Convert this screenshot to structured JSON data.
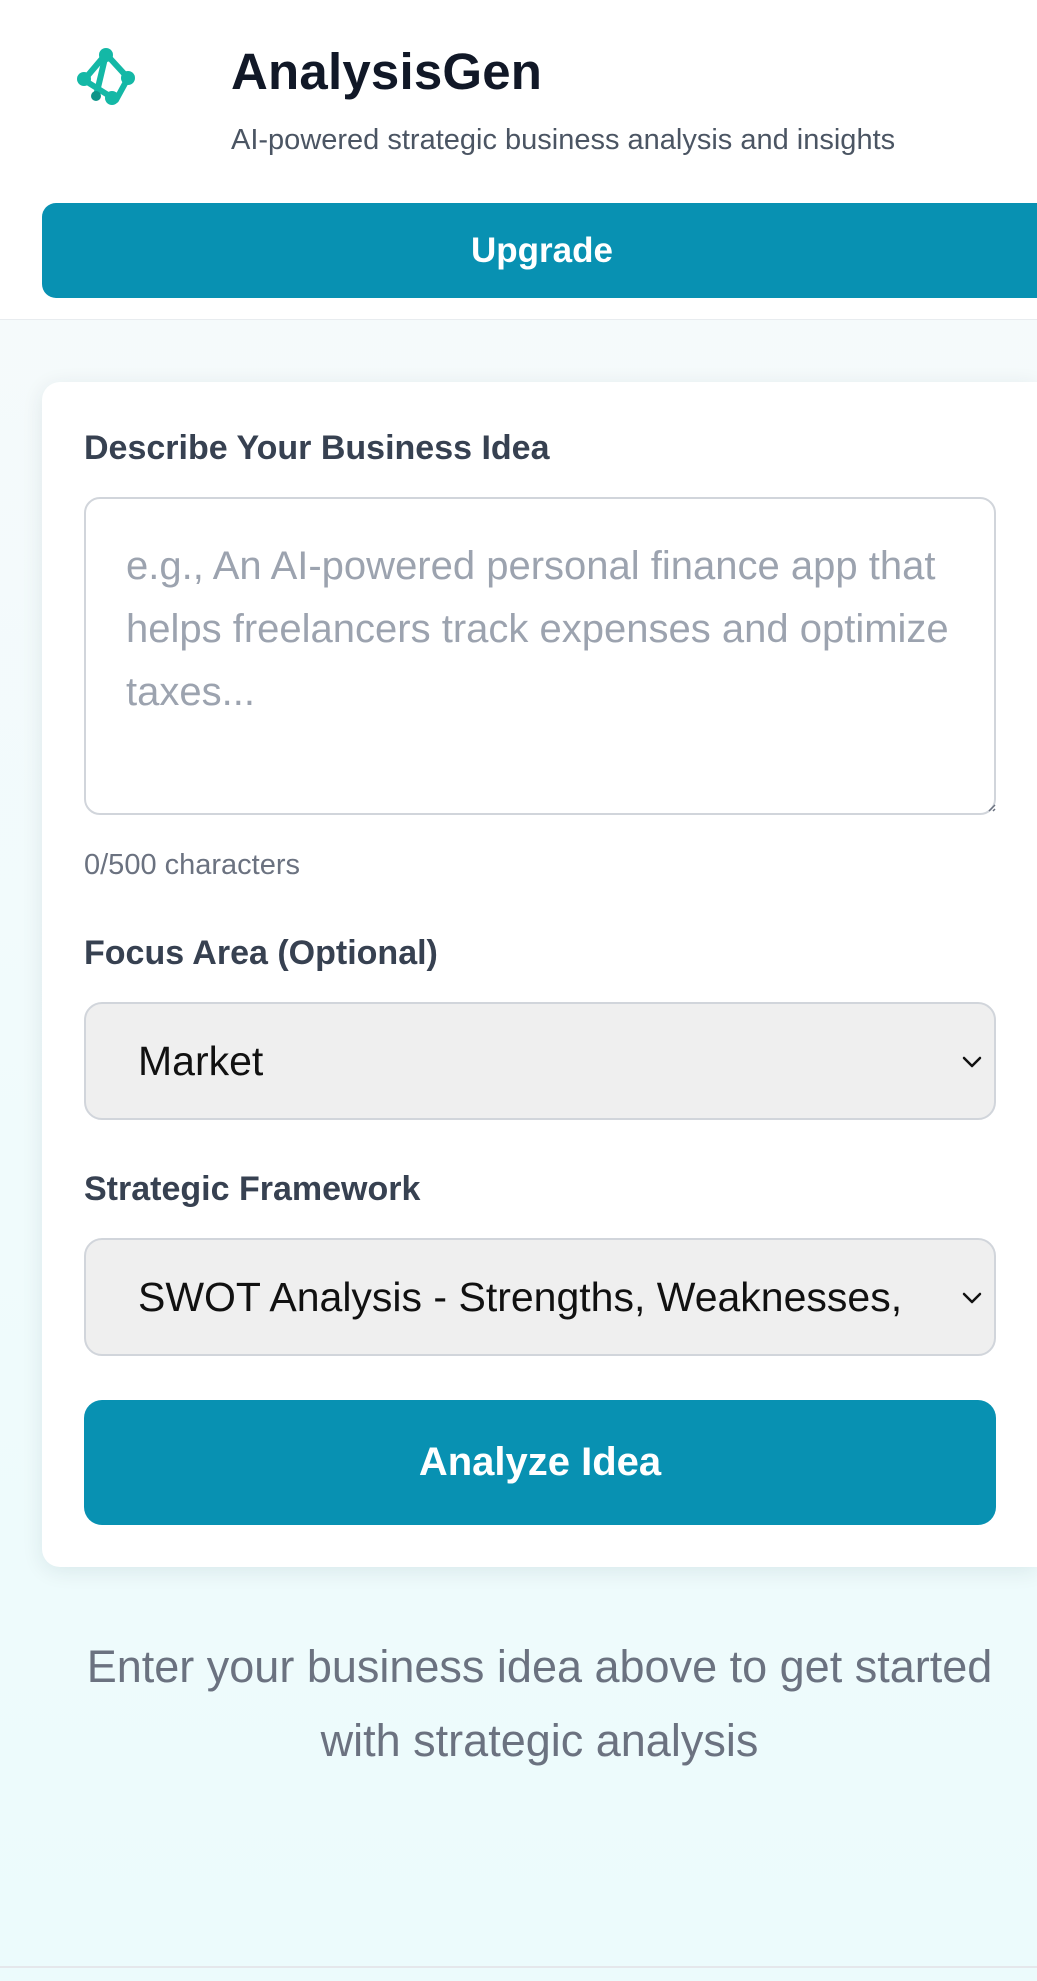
{
  "header": {
    "logo_icon": "network-logo-icon",
    "title": "AnalysisGen",
    "subtitle": "AI-powered strategic business analysis and insights",
    "upgrade_label": "Upgrade"
  },
  "form": {
    "idea_label": "Describe Your Business Idea",
    "idea_value": "",
    "idea_placeholder": "e.g., An AI-powered personal finance app that helps freelancers track expenses and optimize taxes...",
    "char_count": "0/500 characters",
    "focus_label": "Focus Area (Optional)",
    "focus_selected": "Market",
    "framework_label": "Strategic Framework",
    "framework_selected": "SWOT Analysis - Strengths, Weaknesses, Opportunities, Threats",
    "analyze_label": "Analyze Idea"
  },
  "empty_state": {
    "message": "Enter your business idea above to get started with strategic analysis"
  },
  "colors": {
    "accent": "#0891b2",
    "logo": "#14b8a6",
    "page_background": "#f0fbfc"
  }
}
